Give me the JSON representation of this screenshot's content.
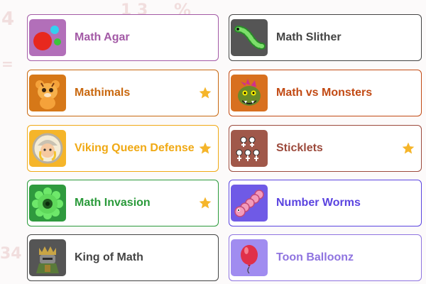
{
  "games": [
    {
      "title": "Math Agar",
      "color": "#a35aa6",
      "tile_color": "#b26fb9",
      "icon": "agar-blobs-icon",
      "featured": false
    },
    {
      "title": "Math Slither",
      "color": "#444444",
      "tile_color": "#555555",
      "icon": "snake-icon",
      "featured": false
    },
    {
      "title": "Mathimals",
      "color": "#c9680f",
      "tile_color": "#d67818",
      "icon": "tiger-cub-icon",
      "featured": true
    },
    {
      "title": "Math vs Monsters",
      "color": "#c24a14",
      "tile_color": "#d8701f",
      "icon": "monster-icon",
      "featured": false
    },
    {
      "title": "Viking Queen Defense",
      "color": "#f0a914",
      "tile_color": "#f5b52a",
      "icon": "viking-queen-icon",
      "featured": true
    },
    {
      "title": "Sticklets",
      "color": "#9c4a3c",
      "tile_color": "#a0584a",
      "icon": "sticklets-icon",
      "featured": true
    },
    {
      "title": "Math Invasion",
      "color": "#2a9a3a",
      "tile_color": "#2f9a3e",
      "icon": "green-virus-icon",
      "featured": true
    },
    {
      "title": "Number Worms",
      "color": "#5b44e0",
      "tile_color": "#6f5ae6",
      "icon": "pink-worm-icon",
      "featured": false
    },
    {
      "title": "King of Math",
      "color": "#444444",
      "tile_color": "#555555",
      "icon": "king-knight-icon",
      "featured": false
    },
    {
      "title": "Toon Balloonz",
      "color": "#8f74e0",
      "tile_color": "#a08cf0",
      "icon": "red-balloon-icon",
      "featured": false
    }
  ],
  "star_color": "#f5b52a"
}
